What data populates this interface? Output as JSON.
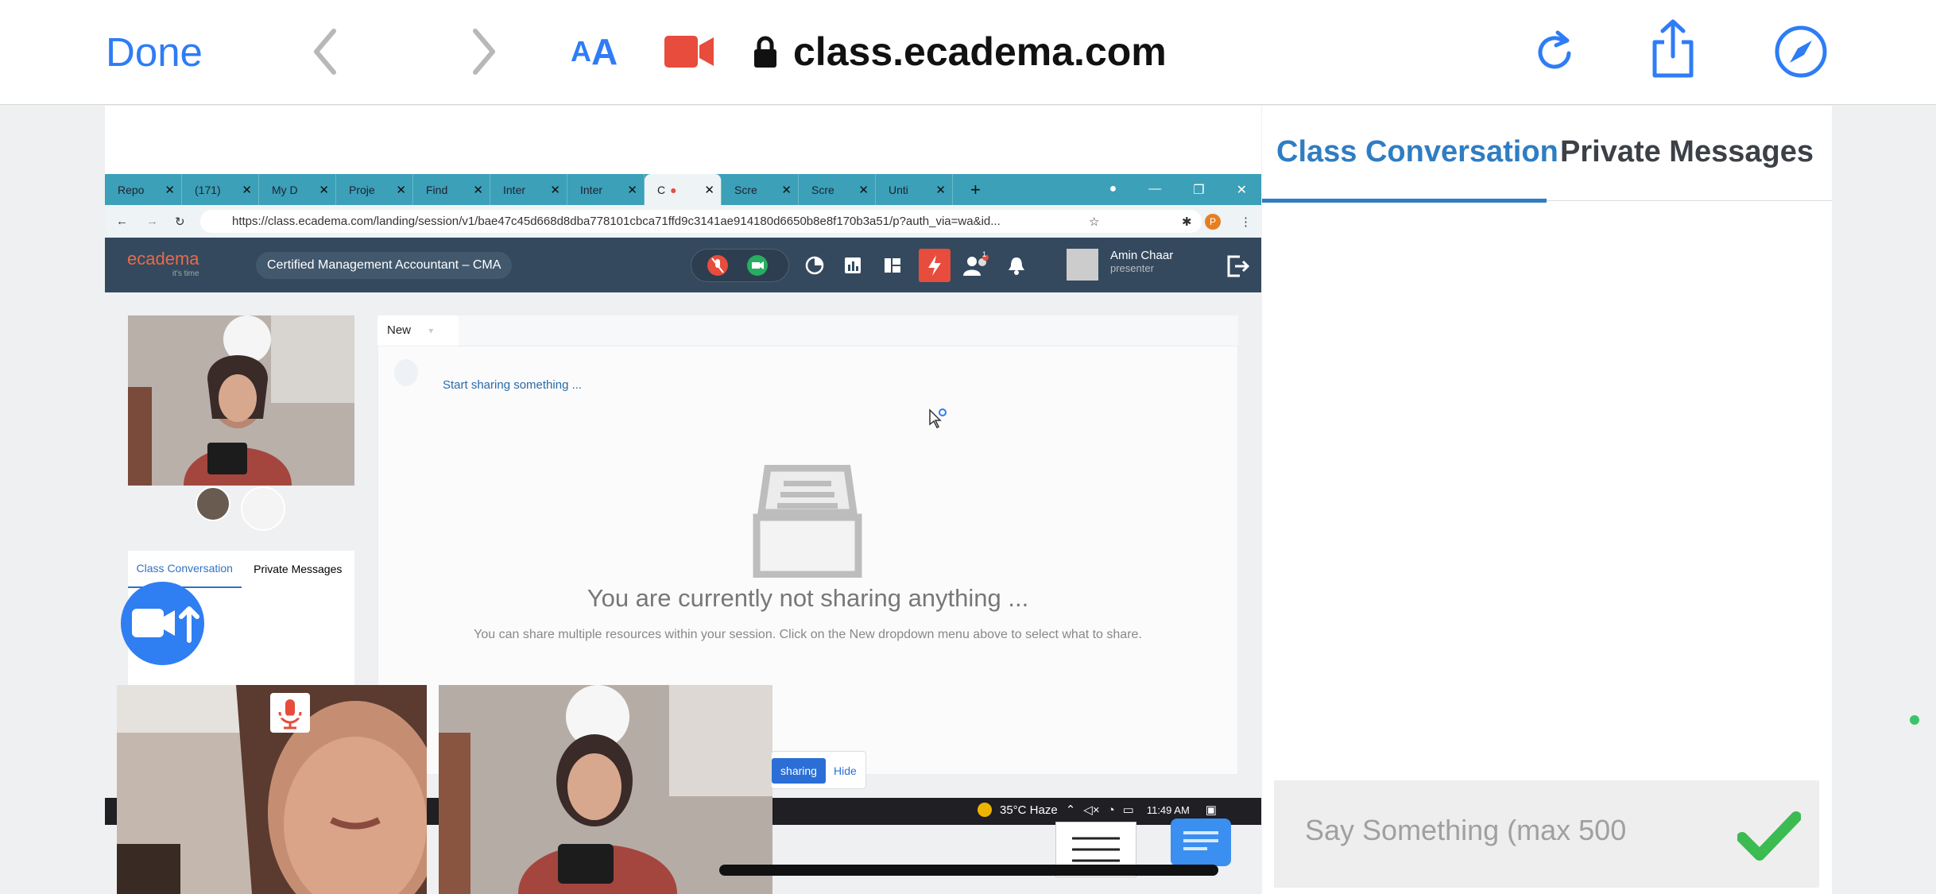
{
  "safari": {
    "done_label": "Done",
    "text_size_small": "A",
    "text_size_large": "A",
    "domain": "class.ecadema.com"
  },
  "chrome": {
    "tabs": [
      "Repo",
      "(171)",
      "My D",
      "Proje",
      "Find",
      "Inter",
      "Inter",
      "C",
      "Scre",
      "Scre",
      "Unti"
    ],
    "new_tab": "+",
    "address": "https://class.ecadema.com/landing/session/v1/bae47c45d668d8dba778101cbca71ffd9c3141ae914180d6650b8e8f170b3a51/p?auth_via=wa&id..."
  },
  "app": {
    "logo": "ecadema",
    "logo_tagline": "it's time",
    "course": "Certified Management Accountant – CMA",
    "user_name": "Amin Chaar",
    "user_role": "presenter",
    "notification_count": "1",
    "profile_initial": "P"
  },
  "stage": {
    "tab_new": "New",
    "start_sharing": "Start sharing something ...",
    "not_sharing": "You are currently not sharing anything ...",
    "hint": "You can share multiple resources within your session. Click on the New dropdown menu above to select what to share.",
    "share_button": "sharing",
    "hide_button": "Hide"
  },
  "left_chat": {
    "tab_class": "Class Conversation",
    "tab_private": "Private Messages"
  },
  "taskbar": {
    "weather": "35°C Haze",
    "time": "11:49 AM"
  },
  "right_panel": {
    "tab_class": "Class Conversation",
    "tab_private": "Private Messages",
    "input_placeholder": "Say Something (max 500"
  },
  "colors": {
    "safari_blue": "#2f7cf6",
    "recording_red": "#e74c3c",
    "app_header": "#34495e",
    "chrome_tabbar": "#3ba0b8",
    "active_tab_blue": "#2f7dc2",
    "send_green": "#3bbb52"
  },
  "icons": [
    "back-icon",
    "forward-icon",
    "record-camera-icon",
    "lock-icon",
    "reload-icon",
    "share-icon",
    "compass-icon",
    "mic-muted-icon",
    "video-icon",
    "bell-icon",
    "logout-icon",
    "checkmark-icon",
    "menu-icon",
    "chat-icon"
  ]
}
